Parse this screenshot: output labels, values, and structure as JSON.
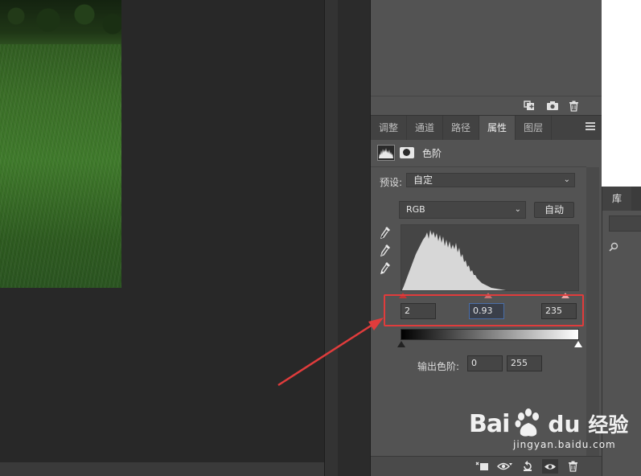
{
  "properties_panel": {
    "tabs": [
      "调整",
      "通道",
      "路径",
      "属性",
      "图层"
    ],
    "active_tab": "属性",
    "title": "色阶",
    "preset_label": "预设:",
    "preset_value": "自定",
    "channel_value": "RGB",
    "auto_button": "自动",
    "input_levels": {
      "black": "2",
      "gamma": "0.93",
      "white": "235"
    },
    "output_label": "输出色阶:",
    "output_levels": {
      "black": "0",
      "white": "255"
    }
  },
  "library_panel": {
    "tab_label": "库"
  },
  "watermark": {
    "brand_left": "Bai",
    "brand_right": "du",
    "product": "经验",
    "url": "jingyan.baidu.com"
  },
  "colors": {
    "annotation_red": "#e03c3c",
    "panel_bg": "#535353",
    "canvas_bg": "#282828"
  },
  "icons": {
    "upper_footer": [
      "new-snapshot-icon",
      "camera-icon",
      "trash-icon"
    ],
    "props_footer": [
      "clip-to-layer-icon",
      "view-previous-icon",
      "reset-icon",
      "visibility-eye-icon",
      "trash-icon"
    ],
    "eyedroppers": [
      "black-point-dropper-icon",
      "gray-point-dropper-icon",
      "white-point-dropper-icon"
    ]
  }
}
